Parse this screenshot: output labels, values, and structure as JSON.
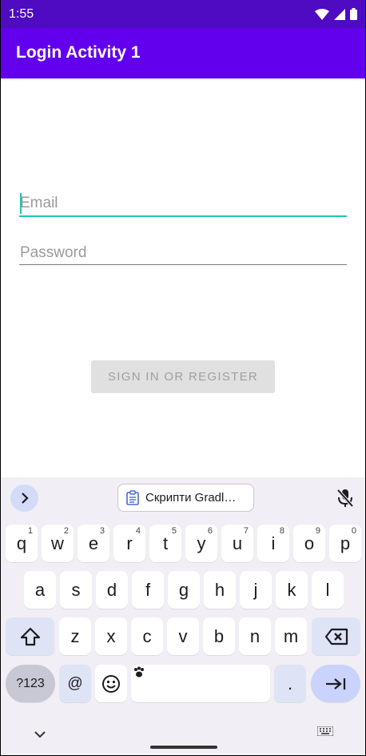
{
  "status_bar": {
    "time": "1:55",
    "icons": [
      "wifi-icon",
      "signal-icon",
      "battery-icon"
    ]
  },
  "app_bar": {
    "title": "Login Activity 1"
  },
  "form": {
    "email": {
      "placeholder": "Email",
      "value": ""
    },
    "password": {
      "placeholder": "Password",
      "value": ""
    },
    "sign_in_label": "SIGN IN OR REGISTER"
  },
  "keyboard": {
    "clipboard_suggestion": "Скрипти Gradl…",
    "row1": [
      {
        "k": "q",
        "h": "1"
      },
      {
        "k": "w",
        "h": "2"
      },
      {
        "k": "e",
        "h": "3"
      },
      {
        "k": "r",
        "h": "4"
      },
      {
        "k": "t",
        "h": "5"
      },
      {
        "k": "y",
        "h": "6"
      },
      {
        "k": "u",
        "h": "7"
      },
      {
        "k": "i",
        "h": "8"
      },
      {
        "k": "o",
        "h": "9"
      },
      {
        "k": "p",
        "h": "0"
      }
    ],
    "row2": [
      "a",
      "s",
      "d",
      "f",
      "g",
      "h",
      "j",
      "k",
      "l"
    ],
    "row3": [
      "z",
      "x",
      "c",
      "v",
      "b",
      "n",
      "m"
    ],
    "symbols_label": "?123",
    "at_label": "@",
    "period_label": "."
  },
  "colors": {
    "status_bar": "#4f0bc1",
    "app_bar": "#6200ee",
    "accent": "#1fc5b5",
    "button_disabled": "#e0e0e0"
  }
}
